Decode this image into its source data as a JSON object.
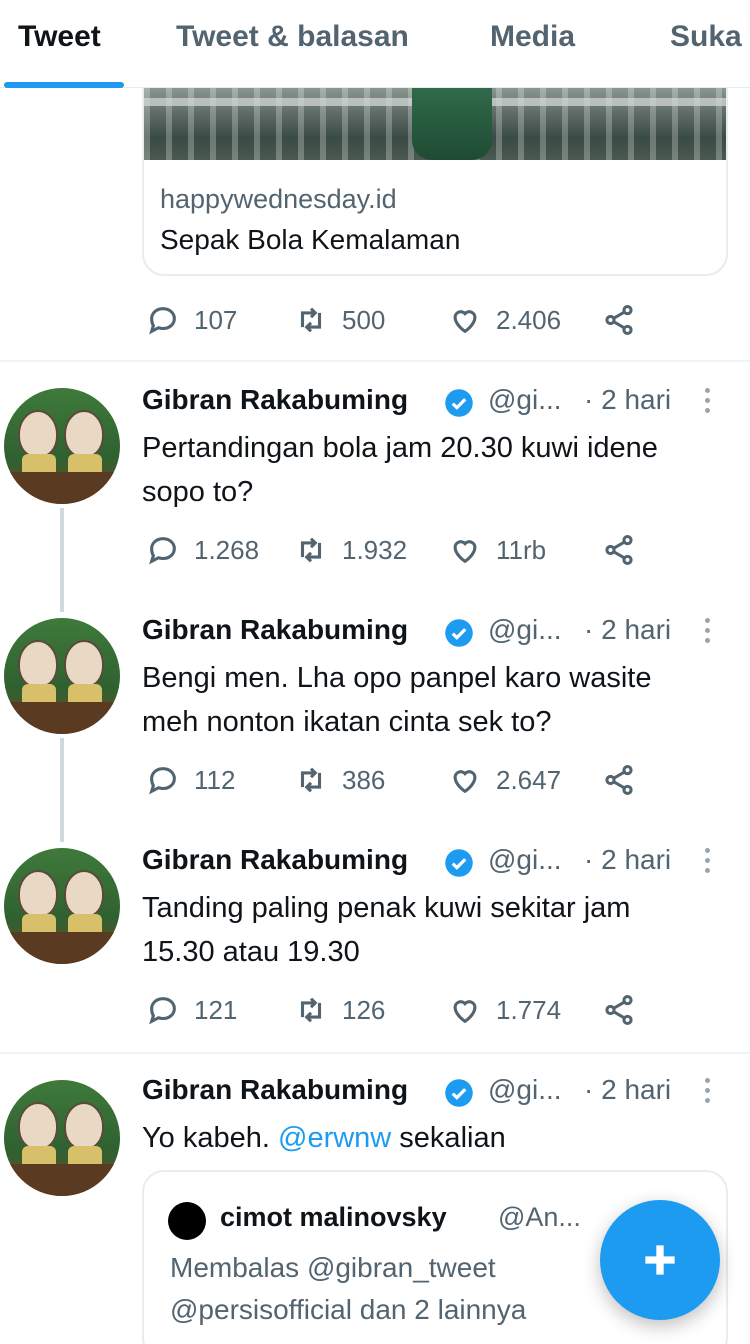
{
  "tabs": [
    "Tweet",
    "Tweet & balasan",
    "Media",
    "Suka"
  ],
  "link_card": {
    "domain": "happywednesday.id",
    "title": "Sepak Bola Kemalaman"
  },
  "top_actions": {
    "replies": "107",
    "retweets": "500",
    "likes": "2.406"
  },
  "tweets": [
    {
      "name": "Gibran Rakabuming",
      "handle": "@gi...",
      "time": "· 2 hari",
      "text_lines": [
        "Pertandingan bola jam 20.30 kuwi idene",
        "sopo to?"
      ],
      "replies": "1.268",
      "retweets": "1.932",
      "likes": "11rb"
    },
    {
      "name": "Gibran Rakabuming",
      "handle": "@gi...",
      "time": "· 2 hari",
      "text_lines": [
        "Bengi men. Lha opo panpel karo wasite",
        "meh nonton ikatan cinta sek to?"
      ],
      "replies": "112",
      "retweets": "386",
      "likes": "2.647"
    },
    {
      "name": "Gibran Rakabuming",
      "handle": "@gi...",
      "time": "· 2 hari",
      "text_lines": [
        "Tanding paling penak kuwi sekitar jam",
        "15.30 atau 19.30"
      ],
      "replies": "121",
      "retweets": "126",
      "likes": "1.774"
    },
    {
      "name": "Gibran Rakabuming",
      "handle": "@gi...",
      "time": "· 2 hari",
      "text_before": "Yo kabeh. ",
      "mention": "@erwnw",
      "text_after": " sekalian"
    }
  ],
  "quote": {
    "name": "cimot malinovsky",
    "handle": "@An...",
    "line1": "Membalas @gibran_tweet",
    "line2": "@persisofficial dan 2 lainnya"
  },
  "colors": {
    "accent": "#1d9bf0",
    "secondary_text": "#536471"
  },
  "icons": [
    "reply-icon",
    "retweet-icon",
    "like-icon",
    "share-icon",
    "verified-badge-icon",
    "more-icon",
    "compose-plus-icon"
  ]
}
